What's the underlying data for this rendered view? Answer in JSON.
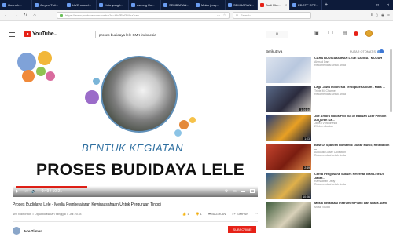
{
  "browser": {
    "tabs": [
      {
        "label": "tiketruth..."
      },
      {
        "label": "Jurgen Tuti..."
      },
      {
        "label": "LIVE sound..."
      },
      {
        "label": "Kata yang t..."
      },
      {
        "label": "aseong Ko..."
      },
      {
        "label": "SEMBARAN..."
      },
      {
        "label": "Muka (Lag..."
      },
      {
        "label": "SEMBARAN..."
      },
      {
        "label": "Budi Rke..."
      },
      {
        "label": "EDOTF RPT..."
      }
    ],
    "address": "https://www.youtube.com/watch?v=Hb7Rbl3Wbz2rex",
    "search_placeholder": "Search"
  },
  "youtube": {
    "logo_text": "YouTube",
    "logo_cc": "ID",
    "search_value": "proses budidaya lele SMK indonesia",
    "colors": {
      "brand_red": "#e62117",
      "accent_blue": "#2e6fa0"
    }
  },
  "player": {
    "subtitle": "BENTUK KEGIATAN",
    "title": "PROSES BUDIDAYA LELE",
    "time": "0:49 / 10:21",
    "progress_fraction": 0.3
  },
  "video": {
    "title": "Proses Budidaya Lele - Media Pembelajaran Kewirausahaan Untuk Perguruan Tinggi",
    "views": "1rb x ditonton • Dipublikasikan tanggal 5 Jul 2018",
    "likes": "1",
    "dislikes": "1",
    "share": "BAGIKAN",
    "save": "SIMPAN",
    "channel": "Ade Tilman",
    "subscribe": "SUBSCRIBE"
  },
  "sidebar": {
    "label": "Berikutnya",
    "autoplay": "PUTAR OTOMATIS",
    "items": [
      {
        "title": "CARA BUDIDAYA IKAN LELE SANGAT MUDAH",
        "channel": "Ahmad Dani",
        "meta": "Rekomendasi untuk Anda",
        "duration": "",
        "colors": [
          "#dde4ef",
          "#b8c7de",
          "#f4f4f4"
        ]
      },
      {
        "title": "Lagu Jawa Indonesia Terpopuler Album - Mars ...",
        "channel": "Triple M. Channel",
        "meta": "Rekomendasi untuk Anda",
        "duration": "1:04:44",
        "colors": [
          "#5a6b8a",
          "#2b2b3d",
          "#d8d2c9"
        ]
      },
      {
        "title": "Joe Amora Nonis Full Jul 30 Baksan Acer Pemilih Al Quran Ka...",
        "channel": "Jaya TV Indonesia",
        "meta": "29 rb x ditonton",
        "duration": "1:03",
        "colors": [
          "#1f3a7a",
          "#e9a023",
          "#0c1a3c"
        ]
      },
      {
        "title": "Best Of Spanish Romantic Guitar Music, Relaxation ...",
        "channel": "Acoustic Guitar Collection",
        "meta": "Rekomendasi untuk Anda",
        "duration": "2:49",
        "colors": [
          "#c8452e",
          "#7a1d10",
          "#e38b4a"
        ]
      },
      {
        "title": "Cerita Pengusaha Sukses Peternak Ikan Lele Di Jabar...",
        "channel": "Ramadhan Dedy",
        "meta": "Rekomendasi untuk Anda",
        "duration": "10:06",
        "colors": [
          "#2c5a8c",
          "#e0b04a",
          "#1b2b48"
        ]
      },
      {
        "title": "Musik Relaksasi Instrumen Piano dan Suara Alam",
        "channel": "Musik Studio",
        "meta": "",
        "duration": "",
        "colors": [
          "#3c5a3a",
          "#d9d1b9",
          "#1f2b1c"
        ]
      }
    ]
  }
}
